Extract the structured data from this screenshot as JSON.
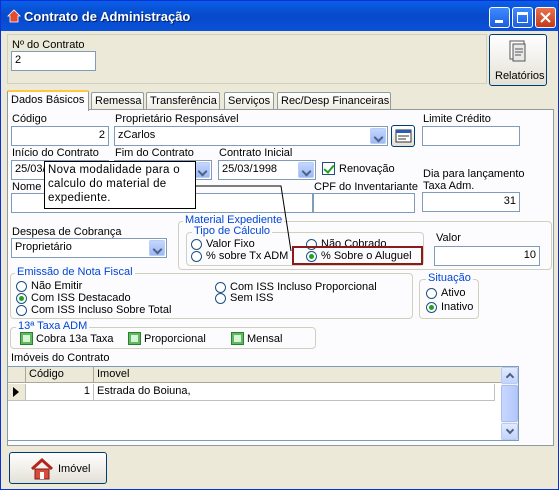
{
  "window": {
    "title": "Contrato de Administração"
  },
  "header": {
    "contract_no_label": "Nº do Contrato",
    "contract_no_value": "2",
    "reports_button": "Relatórios"
  },
  "tabs": [
    "Dados Básicos",
    "Remessa",
    "Transferência",
    "Serviços",
    "Rec/Desp Financeiras"
  ],
  "fields": {
    "codigo_label": "Código",
    "codigo_value": "2",
    "proprietario_label": "Proprietário Responsável",
    "proprietario_value": "zCarlos",
    "limite_label": "Limite Crédito",
    "limite_value": "",
    "inicio_label": "Início do Contrato",
    "inicio_value": "25/03/",
    "fim_label": "Fim do Contrato",
    "fim_value": "",
    "contrato_inicial_label": "Contrato Inicial",
    "contrato_inicial_value": "25/03/1998",
    "renovacao_label": "Renovação",
    "dia_label_1": "Dia para lançamento",
    "dia_label_2": "Taxa Adm.",
    "dia_value": "31",
    "nome_label": "Nome I",
    "cpf_label": "CPF do Inventariante",
    "cpf_value": "",
    "despesa_label": "Despesa de Cobrança",
    "despesa_value": "Proprietário",
    "valor_label": "Valor",
    "valor_value": "10"
  },
  "tooltip": {
    "text": "Nova modalidade para o calculo do material de expediente."
  },
  "material": {
    "title": "Material Expediente",
    "calc_title": "Tipo de Cálculo",
    "opt_valor_fixo": "Valor Fixo",
    "opt_sobre_tx": "% sobre Tx ADM",
    "opt_nao_cobrado": "Não Cobrado",
    "opt_sobre_aluguel": "% Sobre o Aluguel"
  },
  "nota": {
    "title": "Emissão de Nota Fiscal",
    "opt1": "Não Emitir",
    "opt2": "Com ISS Destacado",
    "opt3": "Com ISS Incluso Sobre Total",
    "opt4": "Com ISS Incluso Proporcional",
    "opt5": "Sem ISS"
  },
  "situacao": {
    "title": "Situação",
    "ativo": "Ativo",
    "inativo": "Inativo"
  },
  "taxa13": {
    "title": "13ª Taxa ADM",
    "cobra": "Cobra 13a Taxa",
    "proporcional": "Proporcional",
    "mensal": "Mensal"
  },
  "imoveis": {
    "title": "Imóveis do Contrato",
    "columns": [
      "Código",
      "Imovel"
    ],
    "rows": [
      {
        "codigo": "1",
        "imovel": "Estrada do Boiuna,"
      }
    ]
  },
  "footer": {
    "imovel_button": "Imóvel"
  },
  "colors": {
    "title_bar": "#0a5fe8",
    "highlight_box": "#8b1a1a",
    "group_title": "#0046d5"
  }
}
